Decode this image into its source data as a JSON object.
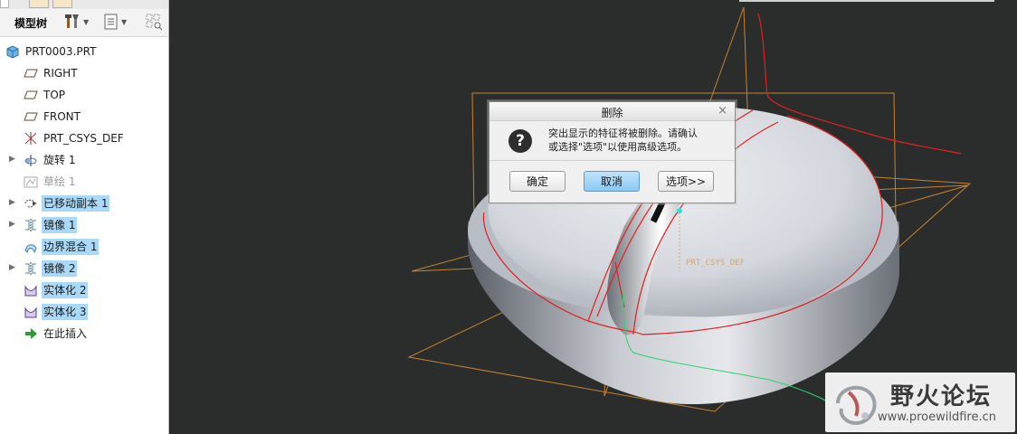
{
  "model_tree": {
    "title": "模型树",
    "items": [
      {
        "label": "PRT0003.PRT",
        "icon": "part-icon",
        "expandable": false,
        "selected": false,
        "dimmed": false
      },
      {
        "label": "RIGHT",
        "icon": "datum-plane-icon",
        "expandable": false,
        "selected": false,
        "dimmed": false
      },
      {
        "label": "TOP",
        "icon": "datum-plane-icon",
        "expandable": false,
        "selected": false,
        "dimmed": false
      },
      {
        "label": "FRONT",
        "icon": "datum-plane-icon",
        "expandable": false,
        "selected": false,
        "dimmed": false
      },
      {
        "label": "PRT_CSYS_DEF",
        "icon": "csys-icon",
        "expandable": false,
        "selected": false,
        "dimmed": false
      },
      {
        "label": "旋转 1",
        "icon": "revolve-icon",
        "expandable": true,
        "selected": false,
        "dimmed": false
      },
      {
        "label": "草绘 1",
        "icon": "sketch-icon",
        "expandable": false,
        "selected": false,
        "dimmed": true
      },
      {
        "label": "已移动副本 1",
        "icon": "moved-copy-icon",
        "expandable": true,
        "selected": true,
        "dimmed": false
      },
      {
        "label": "镜像 1",
        "icon": "mirror-icon",
        "expandable": true,
        "selected": true,
        "dimmed": false
      },
      {
        "label": "边界混合 1",
        "icon": "boundary-blend-icon",
        "expandable": false,
        "selected": true,
        "dimmed": false
      },
      {
        "label": "镜像 2",
        "icon": "mirror-icon",
        "expandable": true,
        "selected": true,
        "dimmed": false
      },
      {
        "label": "实体化 2",
        "icon": "solidify-icon",
        "expandable": false,
        "selected": true,
        "dimmed": false
      },
      {
        "label": "实体化 3",
        "icon": "solidify-icon",
        "expandable": false,
        "selected": true,
        "dimmed": false
      },
      {
        "label": "在此插入",
        "icon": "insert-here-icon",
        "expandable": false,
        "selected": false,
        "dimmed": false
      }
    ]
  },
  "viewport": {
    "csys_label": "PRT_CSYS_DEF"
  },
  "dialog": {
    "title": "删除",
    "close_symbol": "×",
    "icon": "?",
    "message_line1": "突出显示的特征将被删除。请确认",
    "message_line2": "或选择\"选项\"以使用高级选项。",
    "buttons": {
      "ok": "确定",
      "cancel": "取消",
      "options": "选项>>"
    }
  },
  "watermark": {
    "title": "野火论坛",
    "url": "www.proewildfire.cn"
  },
  "colors": {
    "viewport_bg": "#2b2d2d",
    "selection": "#a9d9f7",
    "highlight_edge": "#e02020",
    "datum_plane": "#c7822e",
    "primary_button": "#8bc9f3"
  }
}
